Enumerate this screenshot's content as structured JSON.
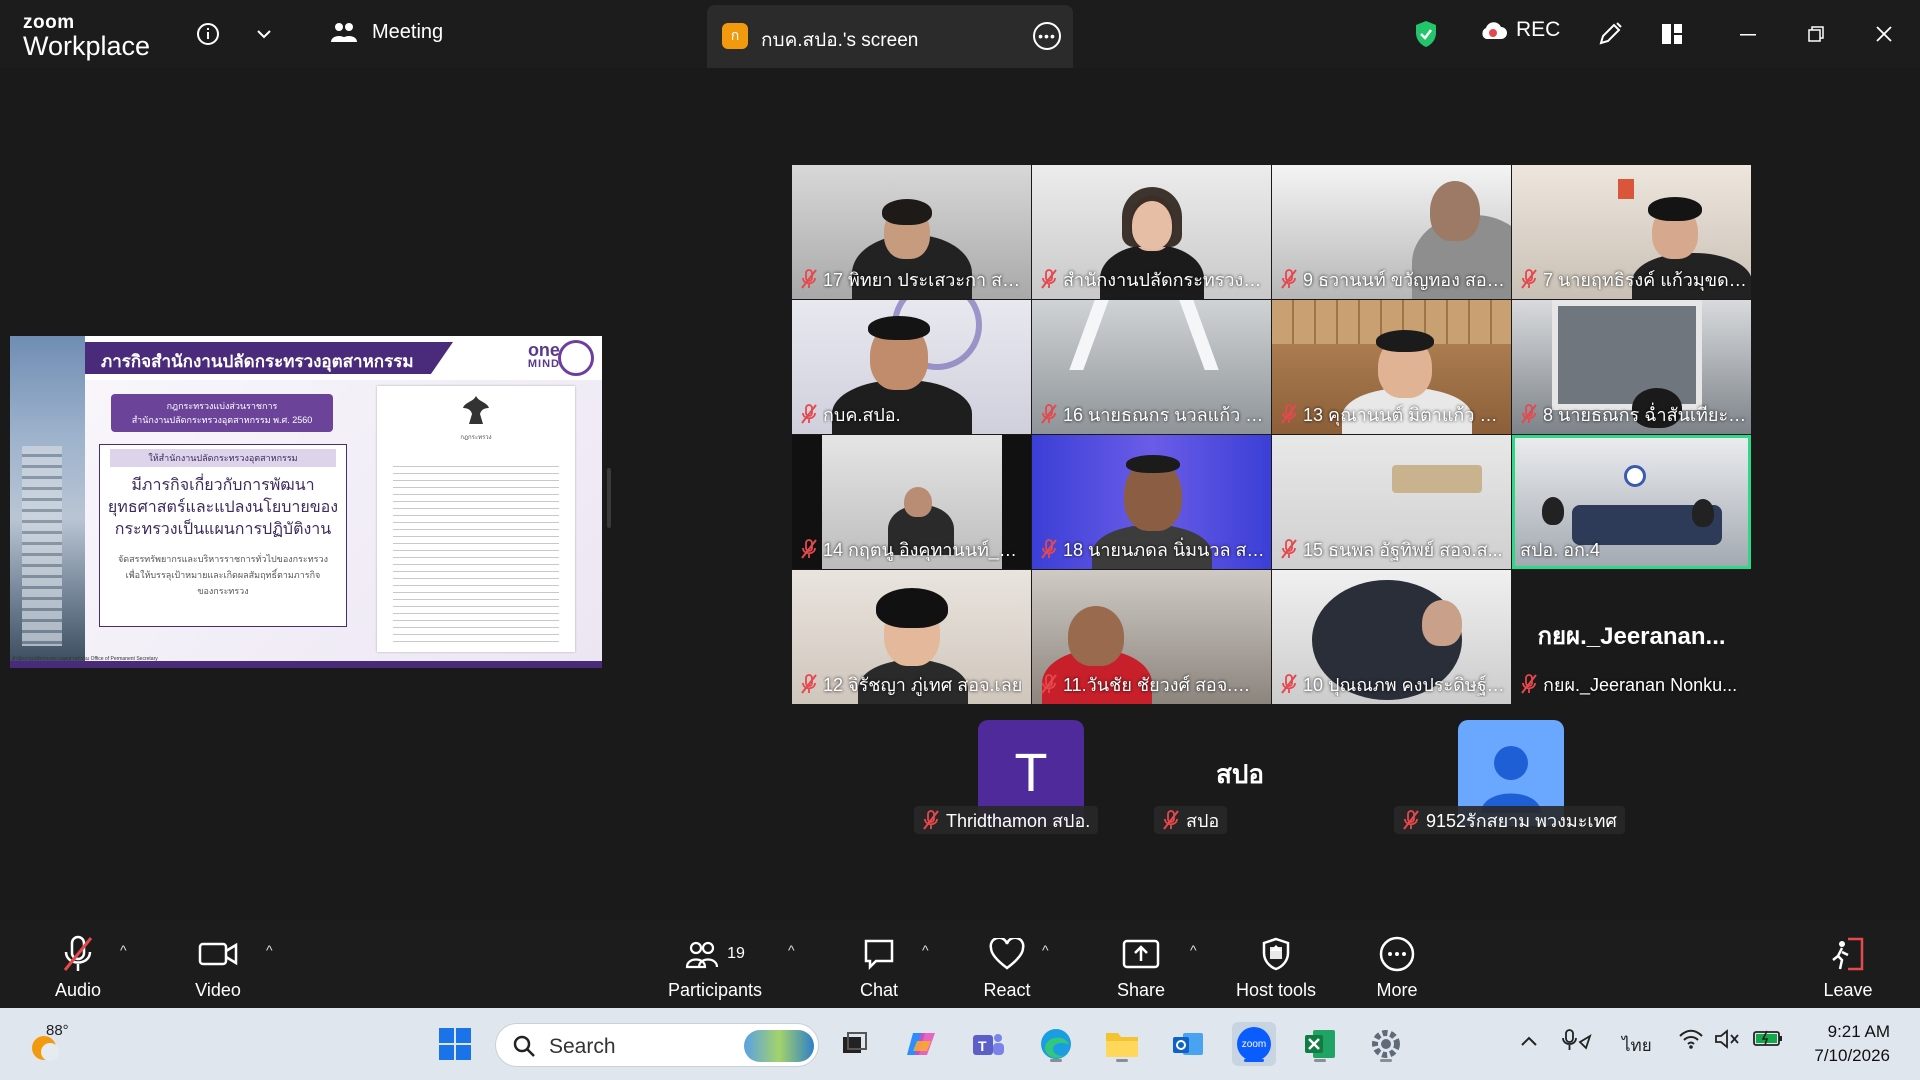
{
  "app": {
    "logo_line1": "zoom",
    "logo_line2": "Workplace",
    "meeting_label": "Meeting",
    "screen_tab_badge": "ก",
    "screen_tab_label": "กบค.สปอ.'s screen",
    "rec_label": "REC"
  },
  "shared_screen": {
    "header_title": "ภารกิจสำนักงานปลัดกระทรวงอุตสาหกรรม",
    "brand_one": "one",
    "brand_mind": "MIND",
    "purple_box_line1": "กฎกระทรวงแบ่งส่วนราชการ",
    "purple_box_line2": "สำนักงานปลัดกระทรวงอุตสาหกรรม พ.ศ. 2560",
    "frame_sub": "ให้สำนักงานปลัดกระทรวงอุตสาหกรรม",
    "frame_big_1": "มีภารกิจเกี่ยวกับการพัฒนา",
    "frame_big_2": "ยุทธศาสตร์และแปลงนโยบายของ",
    "frame_big_3": "กระทรวงเป็นแผนการปฏิบัติงาน",
    "frame_small_1": "จัดสรรทรัพยากรและบริหารราชการทั่วไปของกระทรวง",
    "frame_small_2": "เพื่อให้บรรลุเป้าหมายและเกิดผลสัมฤทธิ์ตามภารกิจ",
    "frame_small_3": "ของกระทรวง",
    "doc_title": "กฎกระทรวง",
    "footer": "สำนักงานปลัดกระทรวงอุตสาหกรรม Office of Permanent Secretary"
  },
  "participants": [
    {
      "name": "17 พิทยา ประเสวะกา สอจ...."
    },
    {
      "name": "สำนักงานปลัดกระทรวงอุต..."
    },
    {
      "name": "9 ธวานนท์ ขวัญทอง สอจ...."
    },
    {
      "name": "7 นายฤทธิรงค์ แก้วมุขดา ..."
    },
    {
      "name": "กบค.สปอ."
    },
    {
      "name": "16 นายธณกร นวลแก้ว สอ..."
    },
    {
      "name": "13 คุณานนต์ มิตาแก้ว สอ..."
    },
    {
      "name": "8 นายธณกร ฉ่ำสันเทียะ_ส..."
    },
    {
      "name": "14 กฤตนู อิงคุทานนท์_สอ..."
    },
    {
      "name": "18 นายนภดล นิ่มนวล สอจ..."
    },
    {
      "name": "15 ธนพล อัฐทิพย์ สอจ.ส..."
    },
    {
      "name": "สปอ. อก.4"
    },
    {
      "name": "12 จิรัชญา ภู่เทศ สอจ.เลย"
    },
    {
      "name": "11.วันชัย ชัยวงศ์ สอจ.ลำปาง"
    },
    {
      "name": "10 ปุณณภพ คงประดิษฐ์ ส..."
    },
    {
      "name": "กยผ._Jeeranan Nonku...",
      "big": "กยผ._Jeeranan..."
    }
  ],
  "avatar_row": [
    {
      "initial": "T",
      "name": "Thridthamon สปอ."
    },
    {
      "big": "สปอ",
      "name": "สปอ"
    },
    {
      "name": "9152รักสยาม พวงมะเทศ"
    }
  ],
  "toolbar": {
    "audio": "Audio",
    "video": "Video",
    "participants": "Participants",
    "participants_count": "19",
    "chat": "Chat",
    "react": "React",
    "share": "Share",
    "host_tools": "Host tools",
    "more": "More",
    "leave": "Leave"
  },
  "taskbar": {
    "weather": "88°",
    "search_label": "Search",
    "zoom_label": "zoom",
    "lang": "ไทย",
    "time": "9:21 AM",
    "date": "7/10/2026"
  },
  "colors": {
    "active_speaker": "#2ed889",
    "muted_red": "#e5484d",
    "zoom_blue": "#0b5cff",
    "avatar_purple": "#4e2a9a",
    "avatar_blue": "#6aa7ff"
  }
}
